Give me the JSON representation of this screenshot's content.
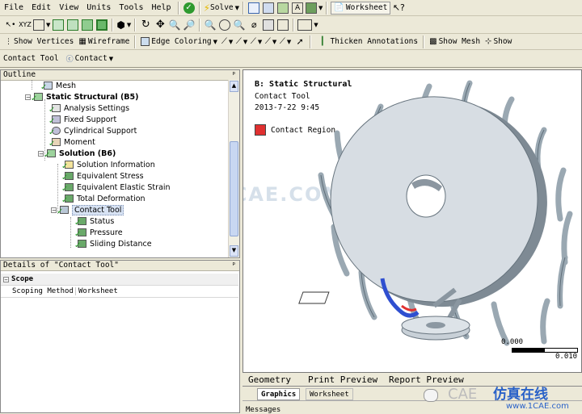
{
  "menu": {
    "file": "File",
    "edit": "Edit",
    "view": "View",
    "units": "Units",
    "tools": "Tools",
    "help": "Help"
  },
  "toolbar1": {
    "solve_label": "Solve",
    "worksheet_label": "Worksheet"
  },
  "toolbar2": {
    "show_vertices": "Show Vertices",
    "wireframe": "Wireframe",
    "edge_coloring": "Edge Coloring",
    "thicken_annotations": "Thicken Annotations",
    "show_mesh": "Show Mesh",
    "show_more": "Show"
  },
  "toolbar3": {
    "contact_tool": "Contact Tool",
    "contact": "Contact"
  },
  "outline": {
    "title": "Outline",
    "items": [
      {
        "label": "Mesh"
      },
      {
        "label": "Static Structural (B5)"
      },
      {
        "label": "Analysis Settings"
      },
      {
        "label": "Fixed Support"
      },
      {
        "label": "Cylindrical Support"
      },
      {
        "label": "Moment"
      },
      {
        "label": "Solution (B6)"
      },
      {
        "label": "Solution Information"
      },
      {
        "label": "Equivalent Stress"
      },
      {
        "label": "Equivalent Elastic Strain"
      },
      {
        "label": "Total Deformation"
      },
      {
        "label": "Contact Tool"
      },
      {
        "label": "Status"
      },
      {
        "label": "Pressure"
      },
      {
        "label": "Sliding Distance"
      }
    ]
  },
  "details": {
    "title": "Details of \"Contact Tool\"",
    "group": "Scope",
    "rows": [
      {
        "key": "Scoping Method",
        "value": "Worksheet"
      }
    ]
  },
  "viewport": {
    "title": "B: Static Structural",
    "subtitle": "Contact Tool",
    "timestamp": "2013-7-22 9:45",
    "legend_label": "Contact Region",
    "legend_color": "#e03030",
    "watermark": "1CAE.COM",
    "scale_min": "0.000",
    "scale_max": "0.010"
  },
  "viewport_tabs": {
    "geometry": "Geometry",
    "print_preview": "Print Preview",
    "report_preview": "Report Preview"
  },
  "sub_tabs": {
    "graphics": "Graphics",
    "worksheet": "Worksheet"
  },
  "messages": {
    "label": "Messages"
  },
  "overlay": {
    "brand_left": "CAE",
    "brand_right": "仿真在线",
    "brand_url": "www.1CAE.com"
  }
}
